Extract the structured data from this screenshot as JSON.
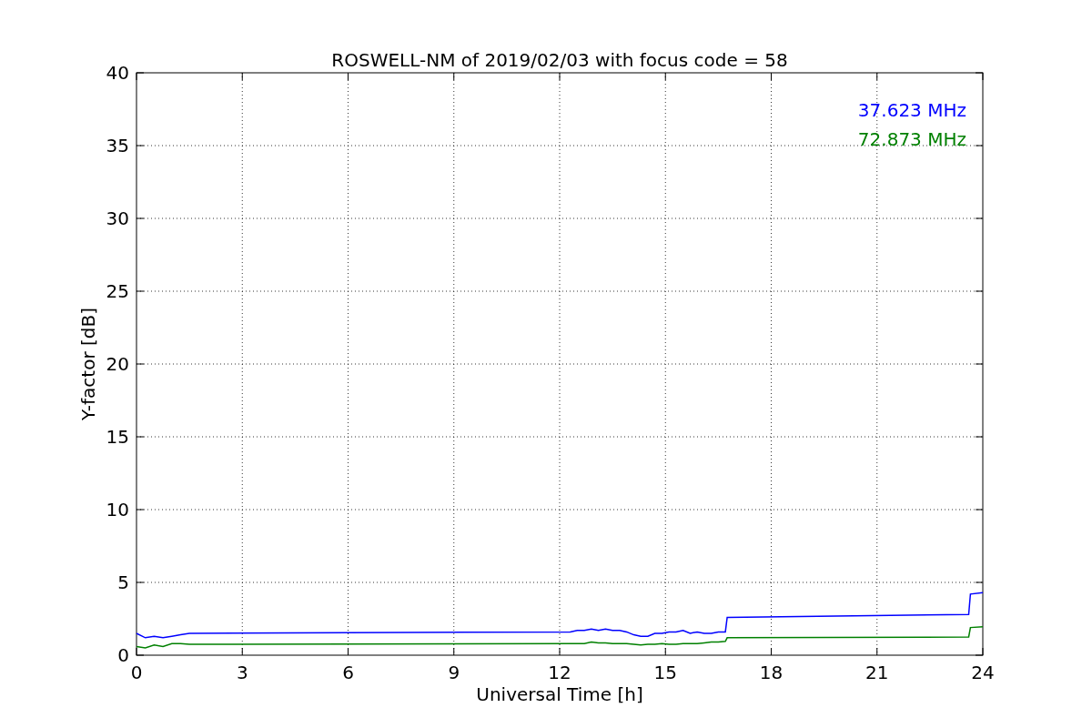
{
  "chart_data": {
    "type": "line",
    "title": "ROSWELL-NM of 2019/02/03 with focus code = 58",
    "xlabel": "Universal Time [h]",
    "ylabel": "Y-factor [dB]",
    "x": [
      0,
      0.25,
      0.5,
      0.75,
      1,
      1.25,
      1.5,
      12.3,
      12.5,
      12.7,
      12.9,
      13.1,
      13.3,
      13.5,
      13.7,
      13.9,
      14.1,
      14.3,
      14.5,
      14.7,
      14.9,
      15.1,
      15.3,
      15.5,
      15.7,
      15.9,
      16.1,
      16.3,
      16.5,
      16.7,
      16.75,
      23.6,
      23.65,
      24
    ],
    "series": [
      {
        "name": "37.623 MHz",
        "color": "#0000ff",
        "values": [
          1.5,
          1.2,
          1.3,
          1.2,
          1.3,
          1.4,
          1.5,
          1.6,
          1.7,
          1.7,
          1.8,
          1.7,
          1.8,
          1.7,
          1.7,
          1.6,
          1.4,
          1.3,
          1.3,
          1.5,
          1.5,
          1.6,
          1.6,
          1.7,
          1.5,
          1.6,
          1.5,
          1.5,
          1.6,
          1.6,
          2.6,
          2.8,
          4.2,
          4.3
        ]
      },
      {
        "name": "72.873 MHz",
        "color": "#008000",
        "values": [
          0.6,
          0.5,
          0.7,
          0.6,
          0.8,
          0.8,
          0.75,
          0.8,
          0.8,
          0.8,
          0.9,
          0.85,
          0.85,
          0.8,
          0.8,
          0.8,
          0.75,
          0.7,
          0.75,
          0.75,
          0.8,
          0.75,
          0.75,
          0.8,
          0.8,
          0.8,
          0.85,
          0.9,
          0.9,
          0.95,
          1.2,
          1.25,
          1.9,
          1.95
        ]
      }
    ],
    "xlim": [
      0,
      24
    ],
    "ylim": [
      0,
      40
    ],
    "xticks": [
      0,
      3,
      6,
      9,
      12,
      15,
      18,
      21,
      24
    ],
    "yticks": [
      0,
      5,
      10,
      15,
      20,
      25,
      30,
      35,
      40
    ],
    "grid": true
  }
}
